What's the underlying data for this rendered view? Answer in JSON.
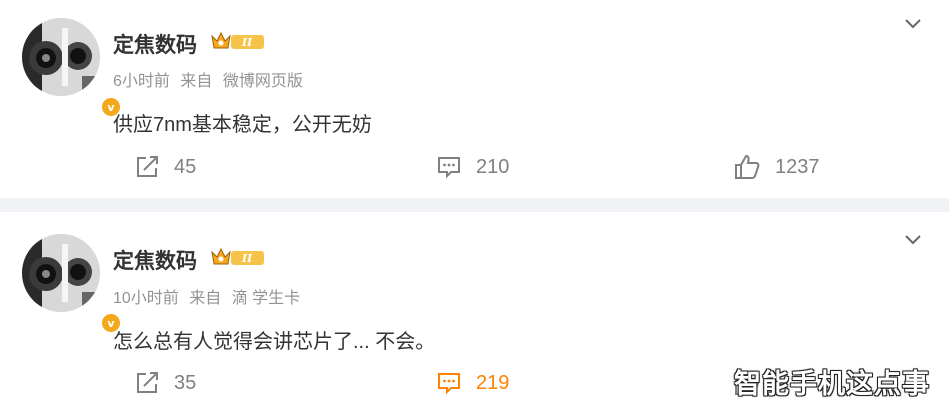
{
  "posts": [
    {
      "author": "定焦数码",
      "time": "6小时前",
      "source_prefix": "来自",
      "source": "微博网页版",
      "content": "供应7nm基本稳定，公开无妨",
      "reposts": "45",
      "comments": "210",
      "likes": "1237"
    },
    {
      "author": "定焦数码",
      "time": "10小时前",
      "source_prefix": "来自",
      "source": "滴 学生卡",
      "content": "怎么总有人觉得会讲芯片了... 不会。",
      "reposts": "35",
      "comments": "219",
      "likes": "",
      "comments_highlighted": true
    }
  ],
  "badges": {
    "verified_mark": "v",
    "rank_level": "II"
  },
  "colors": {
    "accent": "#ff8200",
    "badge": "#f4a81b",
    "text": "#333333",
    "meta": "#939393",
    "divider": "#f1f2f5"
  },
  "watermark": "智能手机这点事"
}
